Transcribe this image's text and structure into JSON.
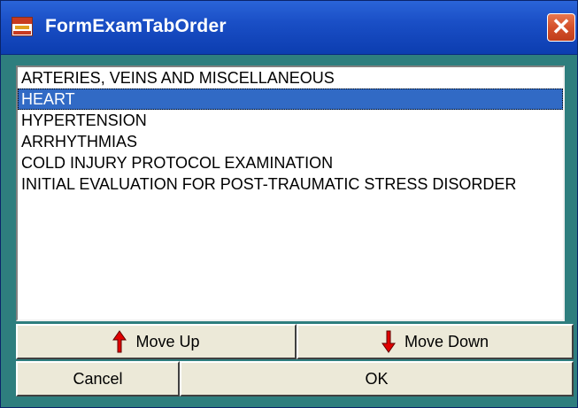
{
  "window": {
    "title": "FormExamTabOrder",
    "close_glyph": "✕",
    "accent_title_color": "#1a4fc6",
    "background_color": "#2e7e7e"
  },
  "list": {
    "items": [
      {
        "label": "ARTERIES, VEINS AND MISCELLANEOUS",
        "selected": false
      },
      {
        "label": "HEART",
        "selected": true
      },
      {
        "label": "HYPERTENSION",
        "selected": false
      },
      {
        "label": "ARRHYTHMIAS",
        "selected": false
      },
      {
        "label": "COLD INJURY PROTOCOL EXAMINATION",
        "selected": false
      },
      {
        "label": "INITIAL EVALUATION FOR POST-TRAUMATIC STRESS DISORDER",
        "selected": false
      }
    ],
    "selection_color": "#316ac5"
  },
  "buttons": {
    "move_up_label": "Move Up",
    "move_up_icon": "red-up-arrow-icon",
    "move_down_label": "Move Down",
    "move_down_icon": "red-down-arrow-icon",
    "cancel_label": "Cancel",
    "ok_label": "OK",
    "arrow_color": "#e00000"
  }
}
